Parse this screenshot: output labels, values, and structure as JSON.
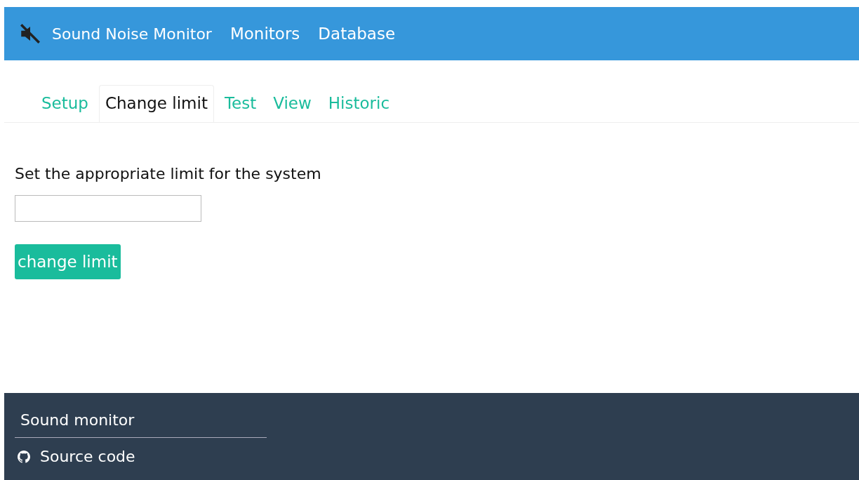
{
  "navbar": {
    "brand": "Sound Noise Monitor",
    "links": [
      "Monitors",
      "Database"
    ]
  },
  "tabs": [
    {
      "label": "Setup",
      "selected": false
    },
    {
      "label": "Change limit",
      "selected": true
    },
    {
      "label": "Test",
      "selected": false
    },
    {
      "label": "View",
      "selected": false
    },
    {
      "label": "Historic",
      "selected": false
    }
  ],
  "form": {
    "label": "Set the appropriate limit for the system",
    "button": "change limit"
  },
  "footer": {
    "title": "Sound monitor",
    "links": [
      "Source code"
    ]
  }
}
